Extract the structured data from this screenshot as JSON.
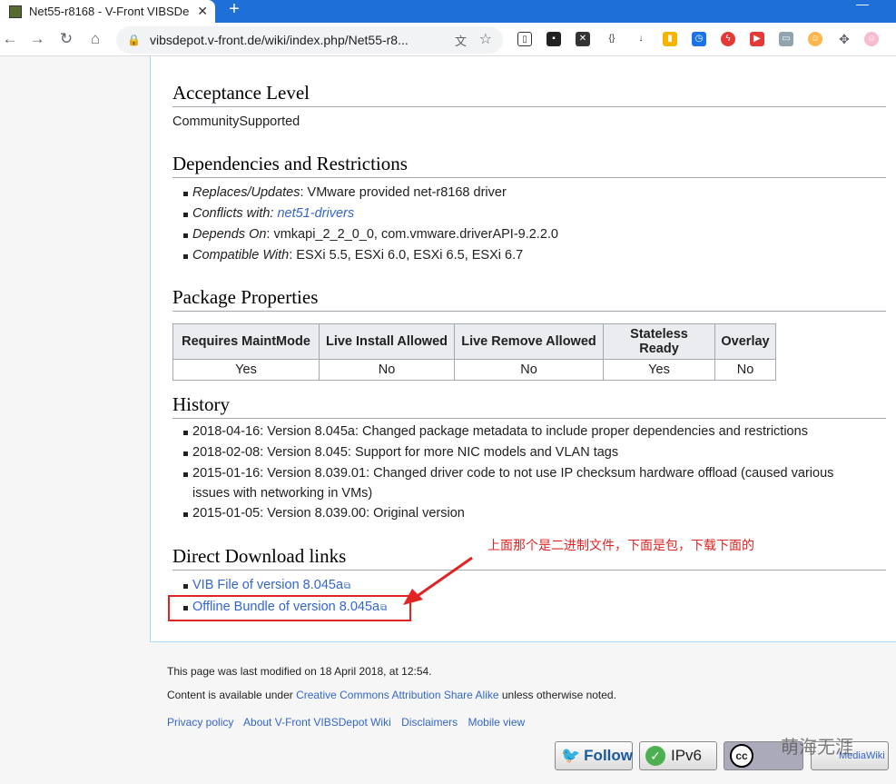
{
  "browser": {
    "tab_title": "Net55-r8168 - V-Front VIBSDe",
    "url": "vibsdepot.v-front.de/wiki/index.php/Net55-r8..."
  },
  "page": {
    "sections": {
      "acceptance": {
        "heading": "Acceptance Level",
        "value": "CommunitySupported"
      },
      "dependencies": {
        "heading": "Dependencies and Restrictions",
        "items": [
          {
            "label": "Replaces/Updates",
            "sep": ":",
            "text": " VMware provided net-r8168 driver"
          },
          {
            "label": "Conflicts with:",
            "sep": "",
            "link": "net51-drivers"
          },
          {
            "label": "Depends On",
            "sep": ":",
            "text": " vmkapi_2_2_0_0, com.vmware.driverAPI-9.2.2.0"
          },
          {
            "label": "Compatible With",
            "sep": ":",
            "text": " ESXi 5.5, ESXi 6.0, ESXi 6.5, ESXi 6.7"
          }
        ]
      },
      "package_properties": {
        "heading": "Package Properties",
        "columns": [
          "Requires MaintMode",
          "Live Install Allowed",
          "Live Remove Allowed",
          "Stateless Ready",
          "Overlay"
        ],
        "row": [
          "Yes",
          "No",
          "No",
          "Yes",
          "No"
        ]
      },
      "history": {
        "heading": "History",
        "items": [
          "2018-04-16: Version 8.045a: Changed package metadata to include proper dependencies and restrictions",
          "2018-02-08: Version 8.045: Support for more NIC models and VLAN tags",
          "2015-01-16: Version 8.039.01: Changed driver code to not use IP checksum hardware offload (caused various issues with networking in VMs)",
          "2015-01-05: Version 8.039.00: Original version"
        ]
      },
      "downloads": {
        "heading": "Direct Download links",
        "links": [
          "VIB File of version 8.045a",
          "Offline Bundle of version 8.045a"
        ]
      }
    },
    "annotation": "上面那个是二进制文件，下面是包，下载下面的",
    "footer": {
      "modified": "This page was last modified on 18 April 2018, at 12:54.",
      "content_prefix": "Content is available under ",
      "license_link": "Creative Commons Attribution Share Alike",
      "content_suffix": " unless otherwise noted.",
      "links": [
        "Privacy policy",
        "About V-Front VIBSDepot Wiki",
        "Disclaimers",
        "Mobile view"
      ]
    },
    "badges": {
      "follow": "Follow",
      "ipv6": "IPv6",
      "cc": "cc",
      "mediawiki": "MediaWiki"
    },
    "watermark": "萌海无涯"
  },
  "colors": {
    "link": "#3366cc",
    "annotation": "#e02424",
    "tabstrip": "#1f6fd8"
  }
}
